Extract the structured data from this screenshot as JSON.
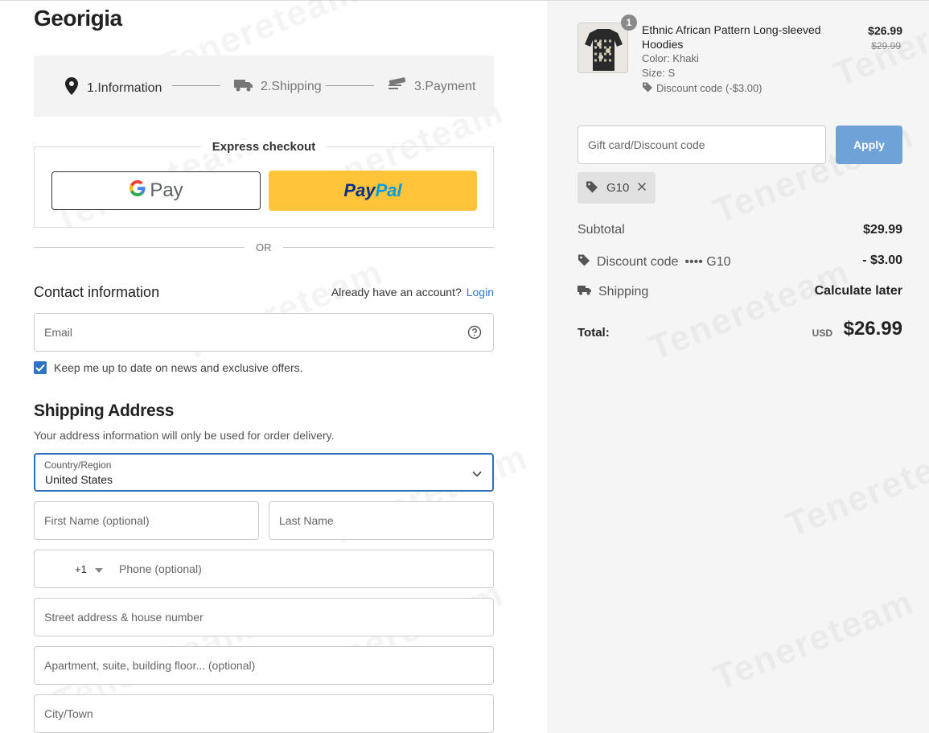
{
  "store": {
    "name": "Georigia"
  },
  "steps": [
    {
      "label": "1.Information",
      "icon": "location-pin-icon"
    },
    {
      "label": "2.Shipping",
      "icon": "truck-icon"
    },
    {
      "label": "3.Payment",
      "icon": "payment-icon"
    }
  ],
  "express": {
    "title": "Express checkout",
    "gpay_label": "Pay",
    "paypal_label_1": "Pay",
    "paypal_label_2": "Pal"
  },
  "divider": {
    "or": "OR"
  },
  "contact": {
    "title": "Contact information",
    "account_prompt": "Already have an account?",
    "login_link": "Login",
    "email_placeholder": "Email",
    "newsletter_label": "Keep me up to date on news and exclusive offers.",
    "newsletter_checked": true
  },
  "shipping": {
    "title": "Shipping Address",
    "subtitle": "Your address information will only be used for order delivery.",
    "country_label": "Country/Region",
    "country_value": "United States",
    "first_name_placeholder": "First Name (optional)",
    "last_name_placeholder": "Last Name",
    "phone_code": "+1",
    "phone_placeholder": "Phone (optional)",
    "street_placeholder": "Street address & house number",
    "apartment_placeholder": "Apartment, suite, building floor... (optional)",
    "city_placeholder": "City/Town"
  },
  "watermark": {
    "text": "Tenereteam"
  },
  "order": {
    "item": {
      "quantity": "1",
      "name": "Ethnic African Pattern Long-sleeved Hoodies",
      "color": "Color: Khaki",
      "size": "Size: S",
      "discount": "Discount code (-$3.00)",
      "price": "$26.99",
      "original_price": "$29.99"
    },
    "gift_placeholder": "Gift card/Discount code",
    "apply_label": "Apply",
    "applied_code": "G10",
    "subtotal_label": "Subtotal",
    "subtotal_value": "$29.99",
    "discount_label": "Discount code",
    "discount_code_display": "•••• G10",
    "discount_value": "- $3.00",
    "shipping_label": "Shipping",
    "shipping_value": "Calculate later",
    "total_label": "Total:",
    "total_currency": "USD",
    "total_value": "$26.99"
  },
  "colors": {
    "accent": "#2f74c0",
    "paypal_yellow": "#ffc439",
    "apply_button": "#6fa3d8"
  }
}
